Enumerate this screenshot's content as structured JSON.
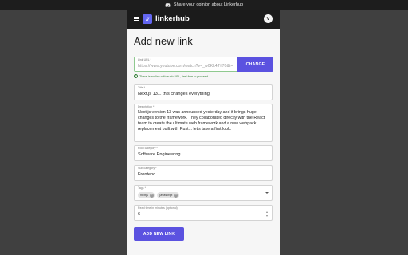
{
  "banner": {
    "text": "Share your opinion about Linkerhub"
  },
  "header": {
    "logo_text": "//",
    "brand": "linkerhub",
    "avatar_initial": "V"
  },
  "form": {
    "title": "Add new link",
    "link_url": {
      "label": "Link URL *",
      "value": "https://www.youtube.com/watch?v=_w0Kk4JY70&t=",
      "change_label": "CHANGE",
      "helper": "There is no link with such URL, feel free to proceed."
    },
    "title_field": {
      "label": "Title *",
      "value": "Next.js 13... this changes everything"
    },
    "description": {
      "label": "Description *",
      "value": "Next.js version 13 was announced yesterday and it brings huge changes to the framework. They collaborated directly with the React team to create the ultimate web framework and a new webpack replacement built with Rust... let's take a first look."
    },
    "root_category": {
      "label": "Root category *",
      "value": "Software Engineering"
    },
    "sub_category": {
      "label": "Sub category *",
      "value": "Frontend"
    },
    "tags": {
      "label": "Tags *",
      "items": [
        "nextjs",
        "javascript"
      ]
    },
    "read_time": {
      "label": "Read time in minutes (optional)",
      "value": "6"
    },
    "submit_label": "ADD NEW LINK"
  },
  "colors": {
    "accent": "#5b52e0",
    "success": "#2e7d32",
    "header_bg": "#1b1b1b",
    "page_bg": "#404040"
  }
}
